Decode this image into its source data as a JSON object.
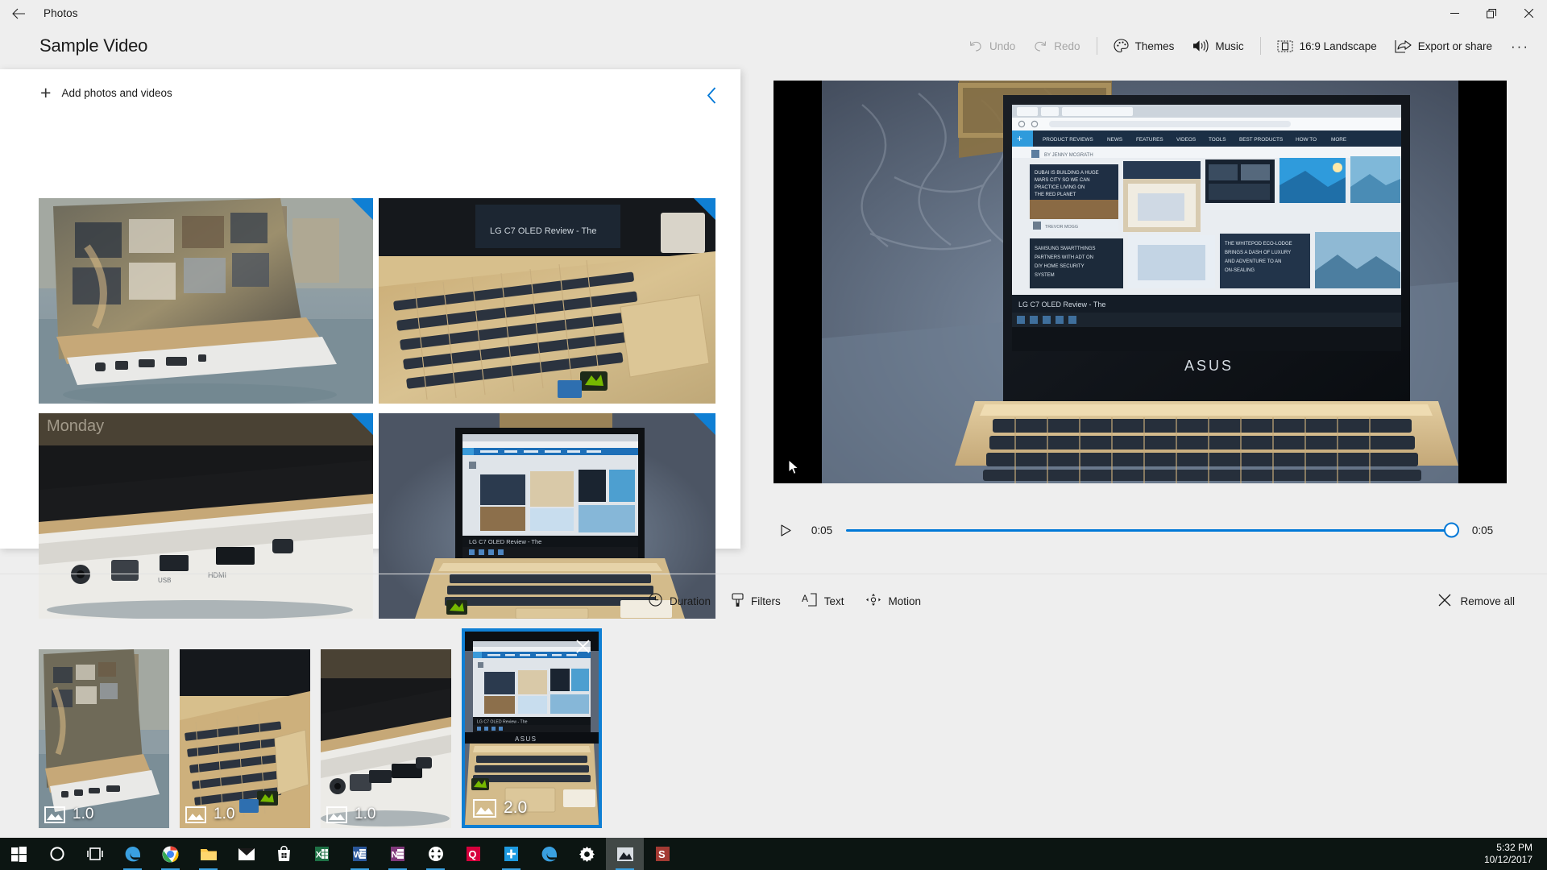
{
  "titlebar": {
    "back_icon": "back-arrow-icon",
    "app_name": "Photos",
    "minimize": "—",
    "restore": "❐",
    "close": "✕"
  },
  "header": {
    "project_title": "Sample Video",
    "tools": [
      {
        "id": "undo",
        "label": "Undo",
        "icon": "undo-icon",
        "disabled": true
      },
      {
        "id": "redo",
        "label": "Redo",
        "icon": "redo-icon",
        "disabled": true
      },
      {
        "id": "themes",
        "label": "Themes",
        "icon": "palette-icon",
        "disabled": false
      },
      {
        "id": "music",
        "label": "Music",
        "icon": "speaker-icon",
        "disabled": false
      },
      {
        "id": "aspect",
        "label": "16:9 Landscape",
        "icon": "aspect-ratio-icon",
        "disabled": false
      },
      {
        "id": "export",
        "label": "Export or share",
        "icon": "share-icon",
        "disabled": false
      }
    ],
    "overflow_label": "···"
  },
  "library": {
    "add_label": "Add photos and videos",
    "add_icon": "plus-icon",
    "collapse_icon": "chevron-left-icon",
    "items": [
      {
        "name": "laptop-screen-angle",
        "used": true
      },
      {
        "name": "laptop-keyboard-gold",
        "used": true
      },
      {
        "name": "laptop-ports-closeup",
        "used": true
      },
      {
        "name": "laptop-open-front-view",
        "used": true
      }
    ]
  },
  "preview": {
    "frame": "asus-laptop-on-carpet",
    "play_icon": "play-icon",
    "current_time": "0:05",
    "total_time": "0:05",
    "progress_percent": 100,
    "accent_color": "#0078D7"
  },
  "storyboard": {
    "tools": [
      {
        "id": "duration",
        "label": "Duration",
        "icon": "clock-icon"
      },
      {
        "id": "filters",
        "label": "Filters",
        "icon": "brush-icon"
      },
      {
        "id": "text",
        "label": "Text",
        "icon": "text-icon"
      },
      {
        "id": "motion",
        "label": "Motion",
        "icon": "motion-icon"
      }
    ],
    "remove_all": {
      "label": "Remove all",
      "icon": "close-x-icon"
    },
    "cards": [
      {
        "duration": "1.0",
        "icon": "photo-icon",
        "selected": false,
        "name": "laptop-screen-angle"
      },
      {
        "duration": "1.0",
        "icon": "photo-icon",
        "selected": false,
        "name": "laptop-keyboard-gold"
      },
      {
        "duration": "1.0",
        "icon": "photo-icon",
        "selected": false,
        "name": "laptop-ports-closeup"
      },
      {
        "duration": "2.0",
        "icon": "photo-icon",
        "selected": true,
        "name": "laptop-open-front-view",
        "close_icon": "close-x-icon"
      }
    ]
  },
  "taskbar": {
    "icons": [
      {
        "name": "start-button",
        "glyph": "start",
        "running": false
      },
      {
        "name": "cortana-button",
        "glyph": "cortana",
        "running": false
      },
      {
        "name": "task-view-button",
        "glyph": "taskview",
        "running": false
      },
      {
        "name": "edge-button",
        "glyph": "edge",
        "running": true
      },
      {
        "name": "chrome-button",
        "glyph": "chrome",
        "running": true
      },
      {
        "name": "explorer-button",
        "glyph": "folder",
        "running": true
      },
      {
        "name": "mail-button",
        "glyph": "mail",
        "running": false
      },
      {
        "name": "store-button",
        "glyph": "store",
        "running": false
      },
      {
        "name": "excel-button",
        "glyph": "excel",
        "running": false
      },
      {
        "name": "word-button",
        "glyph": "word",
        "running": true
      },
      {
        "name": "onenote-button",
        "glyph": "onenote",
        "running": true
      },
      {
        "name": "media-button",
        "glyph": "media",
        "running": true
      },
      {
        "name": "quicken-button",
        "glyph": "quicken",
        "running": false
      },
      {
        "name": "sync-button",
        "glyph": "sync",
        "running": true
      },
      {
        "name": "edge2-button",
        "glyph": "edge",
        "running": false
      },
      {
        "name": "settings-button",
        "glyph": "gear",
        "running": false
      },
      {
        "name": "photos-button",
        "glyph": "photos",
        "running": true,
        "active": true
      },
      {
        "name": "snagit-button",
        "glyph": "snagit",
        "running": false
      }
    ],
    "time": "5:32 PM",
    "date": "10/12/2017",
    "notification_icon": "notification-icon"
  }
}
